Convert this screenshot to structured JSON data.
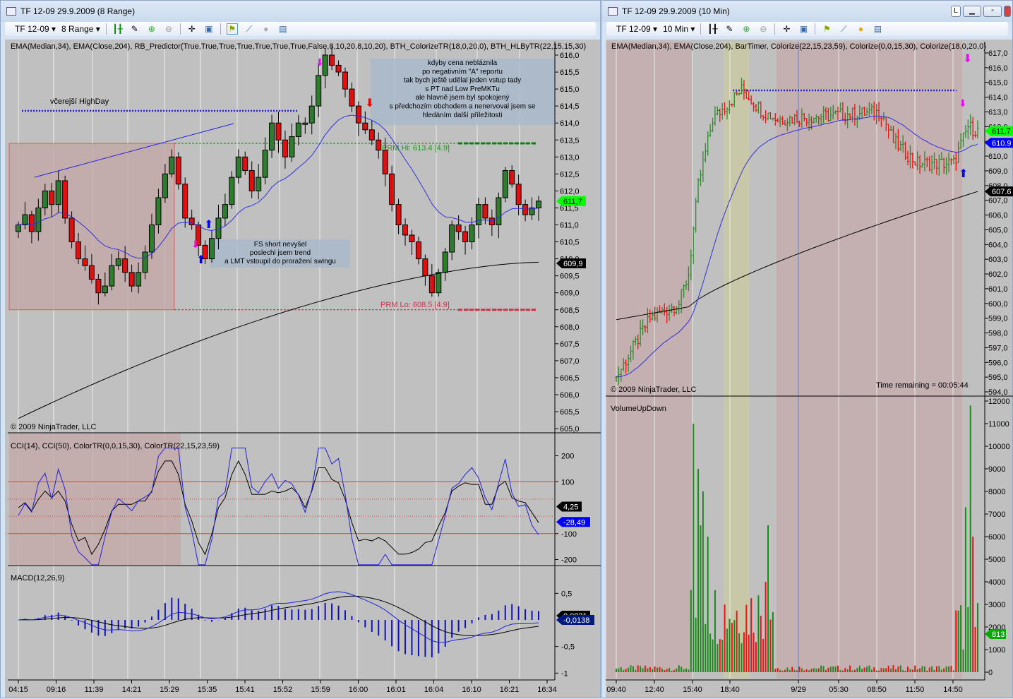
{
  "left": {
    "title": "TF 12-09  29.9.2009 (8 Range)",
    "instrument": "TF 12-09",
    "period": "8 Range",
    "indicators": "EMA(Median,34), EMA(Close,204), RB_Predictor(True,True,True,True,True,True,True,False,8,10,20,8,10,20), BTH_ColorizeTR(18,0,20,0), BTH_HLByTR(22,15,15,30)",
    "note_highday": "včerejší HighDay",
    "note_top": [
      "kdyby cena nebláznila",
      "po negativním \"A\" reportu",
      "tak bych ještě udělal jeden vstup tady",
      "s PT nad Low PreMKTu",
      "ale hlavně jsem byl spokojený",
      "s předchozím obchodem a nenervoval jsem se",
      "hledáním další příležitosti"
    ],
    "note_mid": [
      "FS short nevyšel",
      "poslechl jsem trend",
      "a LMT vstoupil do proražení swingu"
    ],
    "prm_hi": "PRM Hi: 613.4 [4.9]",
    "prm_lo": "PRM Lo: 608.5 [4.9]",
    "copyright": "© 2009 NinjaTrader, LLC",
    "price_ticks": [
      "616,0",
      "615,5",
      "615,0",
      "614,5",
      "614,0",
      "613,5",
      "613,0",
      "612,5",
      "612,0",
      "611,5",
      "611,0",
      "610,5",
      "610,0",
      "609,5",
      "609,0",
      "608,5",
      "608,0",
      "607,5",
      "607,0",
      "606,5",
      "606,0",
      "605,5",
      "605,0"
    ],
    "last_price": "611,7",
    "ema_value": "609,9",
    "cci_label": "CCI(14), CCI(50), ColorTR(0,0,15,30), ColorTR(22,15,23,59)",
    "cci_ticks": [
      "200",
      "100",
      "-100",
      "-200"
    ],
    "cci_val1": "4,25",
    "cci_val2": "-28,49",
    "macd_label": "MACD(12,26,9)",
    "macd_ticks": [
      "0,5",
      "-0,5",
      "-1"
    ],
    "macd_val1": "0,0831",
    "macd_val2": "-0,0138",
    "time_ticks": [
      "04:15",
      "09:16",
      "11:39",
      "14:21",
      "15:29",
      "15:35",
      "15:41",
      "15:52",
      "15:59",
      "16:00",
      "16:01",
      "16:04",
      "16:10",
      "16:21",
      "16:34"
    ]
  },
  "right": {
    "title": "TF 12-09  29.9.2009 (10 Min)",
    "instrument": "TF 12-09",
    "period": "10 Min",
    "indicators": "EMA(Median,34), EMA(Close,204), BarTimer, Colorize(22,15,23,59), Colorize(0,0,15,30), Colorize(18,0,20,0)",
    "copyright": "© 2009 NinjaTrader, LLC",
    "time_remaining": "Time remaining = 00:05:44",
    "price_ticks": [
      "617,0",
      "616,0",
      "615,0",
      "614,0",
      "613,0",
      "612,0",
      "611,0",
      "610,0",
      "609,0",
      "608,0",
      "607,0",
      "606,0",
      "605,0",
      "604,0",
      "603,0",
      "602,0",
      "601,0",
      "600,0",
      "599,0",
      "598,0",
      "597,0",
      "596,0",
      "595,0",
      "594,0"
    ],
    "last_price": "611,7",
    "ema34_value": "610.9",
    "ema204_value": "607.6",
    "volume_label": "VolumeUpDown",
    "volume_ticks": [
      "12000",
      "11000",
      "10000",
      "9000",
      "8000",
      "7000",
      "6000",
      "5000",
      "4000",
      "3000",
      "2000",
      "1000",
      "0"
    ],
    "volume_last": "813",
    "time_ticks": [
      "09:40",
      "12:40",
      "15:40",
      "18:40",
      "9/29",
      "05:30",
      "08:50",
      "11:50",
      "14:50"
    ],
    "win_l": "L"
  },
  "chart_data": [
    {
      "type": "candlestick",
      "name": "left-price",
      "ylim": [
        605,
        616
      ],
      "closes": [
        611,
        611.3,
        610.8,
        611.5,
        612,
        611.6,
        612.3,
        611.2,
        610.5,
        610,
        609.8,
        609.4,
        609,
        609.2,
        609.8,
        610,
        609.6,
        609.2,
        609.6,
        610.2,
        611,
        611.8,
        612.5,
        613,
        612.2,
        611.2,
        611,
        610.4,
        610,
        610.6,
        611.2,
        611.6,
        612.4,
        613,
        612.6,
        612,
        612.4,
        613.2,
        614,
        613.5,
        613,
        613.6,
        614,
        614,
        614.5,
        615.4,
        616,
        615.7,
        615.5,
        615,
        614.5,
        614,
        613.8,
        613.5,
        613.2,
        612.5,
        611.6,
        611,
        610.7,
        610.5,
        610,
        609.5,
        609,
        609.6,
        610.2,
        611,
        610.8,
        610.5,
        611,
        611.6,
        611.2,
        611,
        611.8,
        612.6,
        612.2,
        611.6,
        611.3,
        611.5,
        611.7
      ],
      "ema204": [
        605.3,
        609.9
      ]
    },
    {
      "type": "candlestick",
      "name": "right-price",
      "ylim": [
        594,
        617
      ],
      "path": [
        [
          0,
          595
        ],
        [
          14,
          599
        ],
        [
          26,
          600
        ],
        [
          30,
          602
        ],
        [
          34,
          608
        ],
        [
          40,
          612.5
        ],
        [
          52,
          614.5
        ],
        [
          61,
          613
        ],
        [
          67,
          612.5
        ],
        [
          110,
          613
        ],
        [
          115,
          611
        ],
        [
          125,
          609.5
        ],
        [
          140,
          609.5
        ],
        [
          146,
          612
        ],
        [
          150,
          611.7
        ]
      ]
    },
    {
      "type": "bar",
      "name": "volume",
      "ylim": [
        0,
        12000
      ],
      "peaks": [
        [
          32,
          11000
        ],
        [
          34,
          9000
        ],
        [
          35,
          6500
        ],
        [
          36,
          8000
        ],
        [
          38,
          6000
        ],
        [
          62,
          4000
        ],
        [
          63,
          6500
        ],
        [
          145,
          7300
        ],
        [
          147,
          11800
        ],
        [
          148,
          6000
        ]
      ]
    }
  ]
}
